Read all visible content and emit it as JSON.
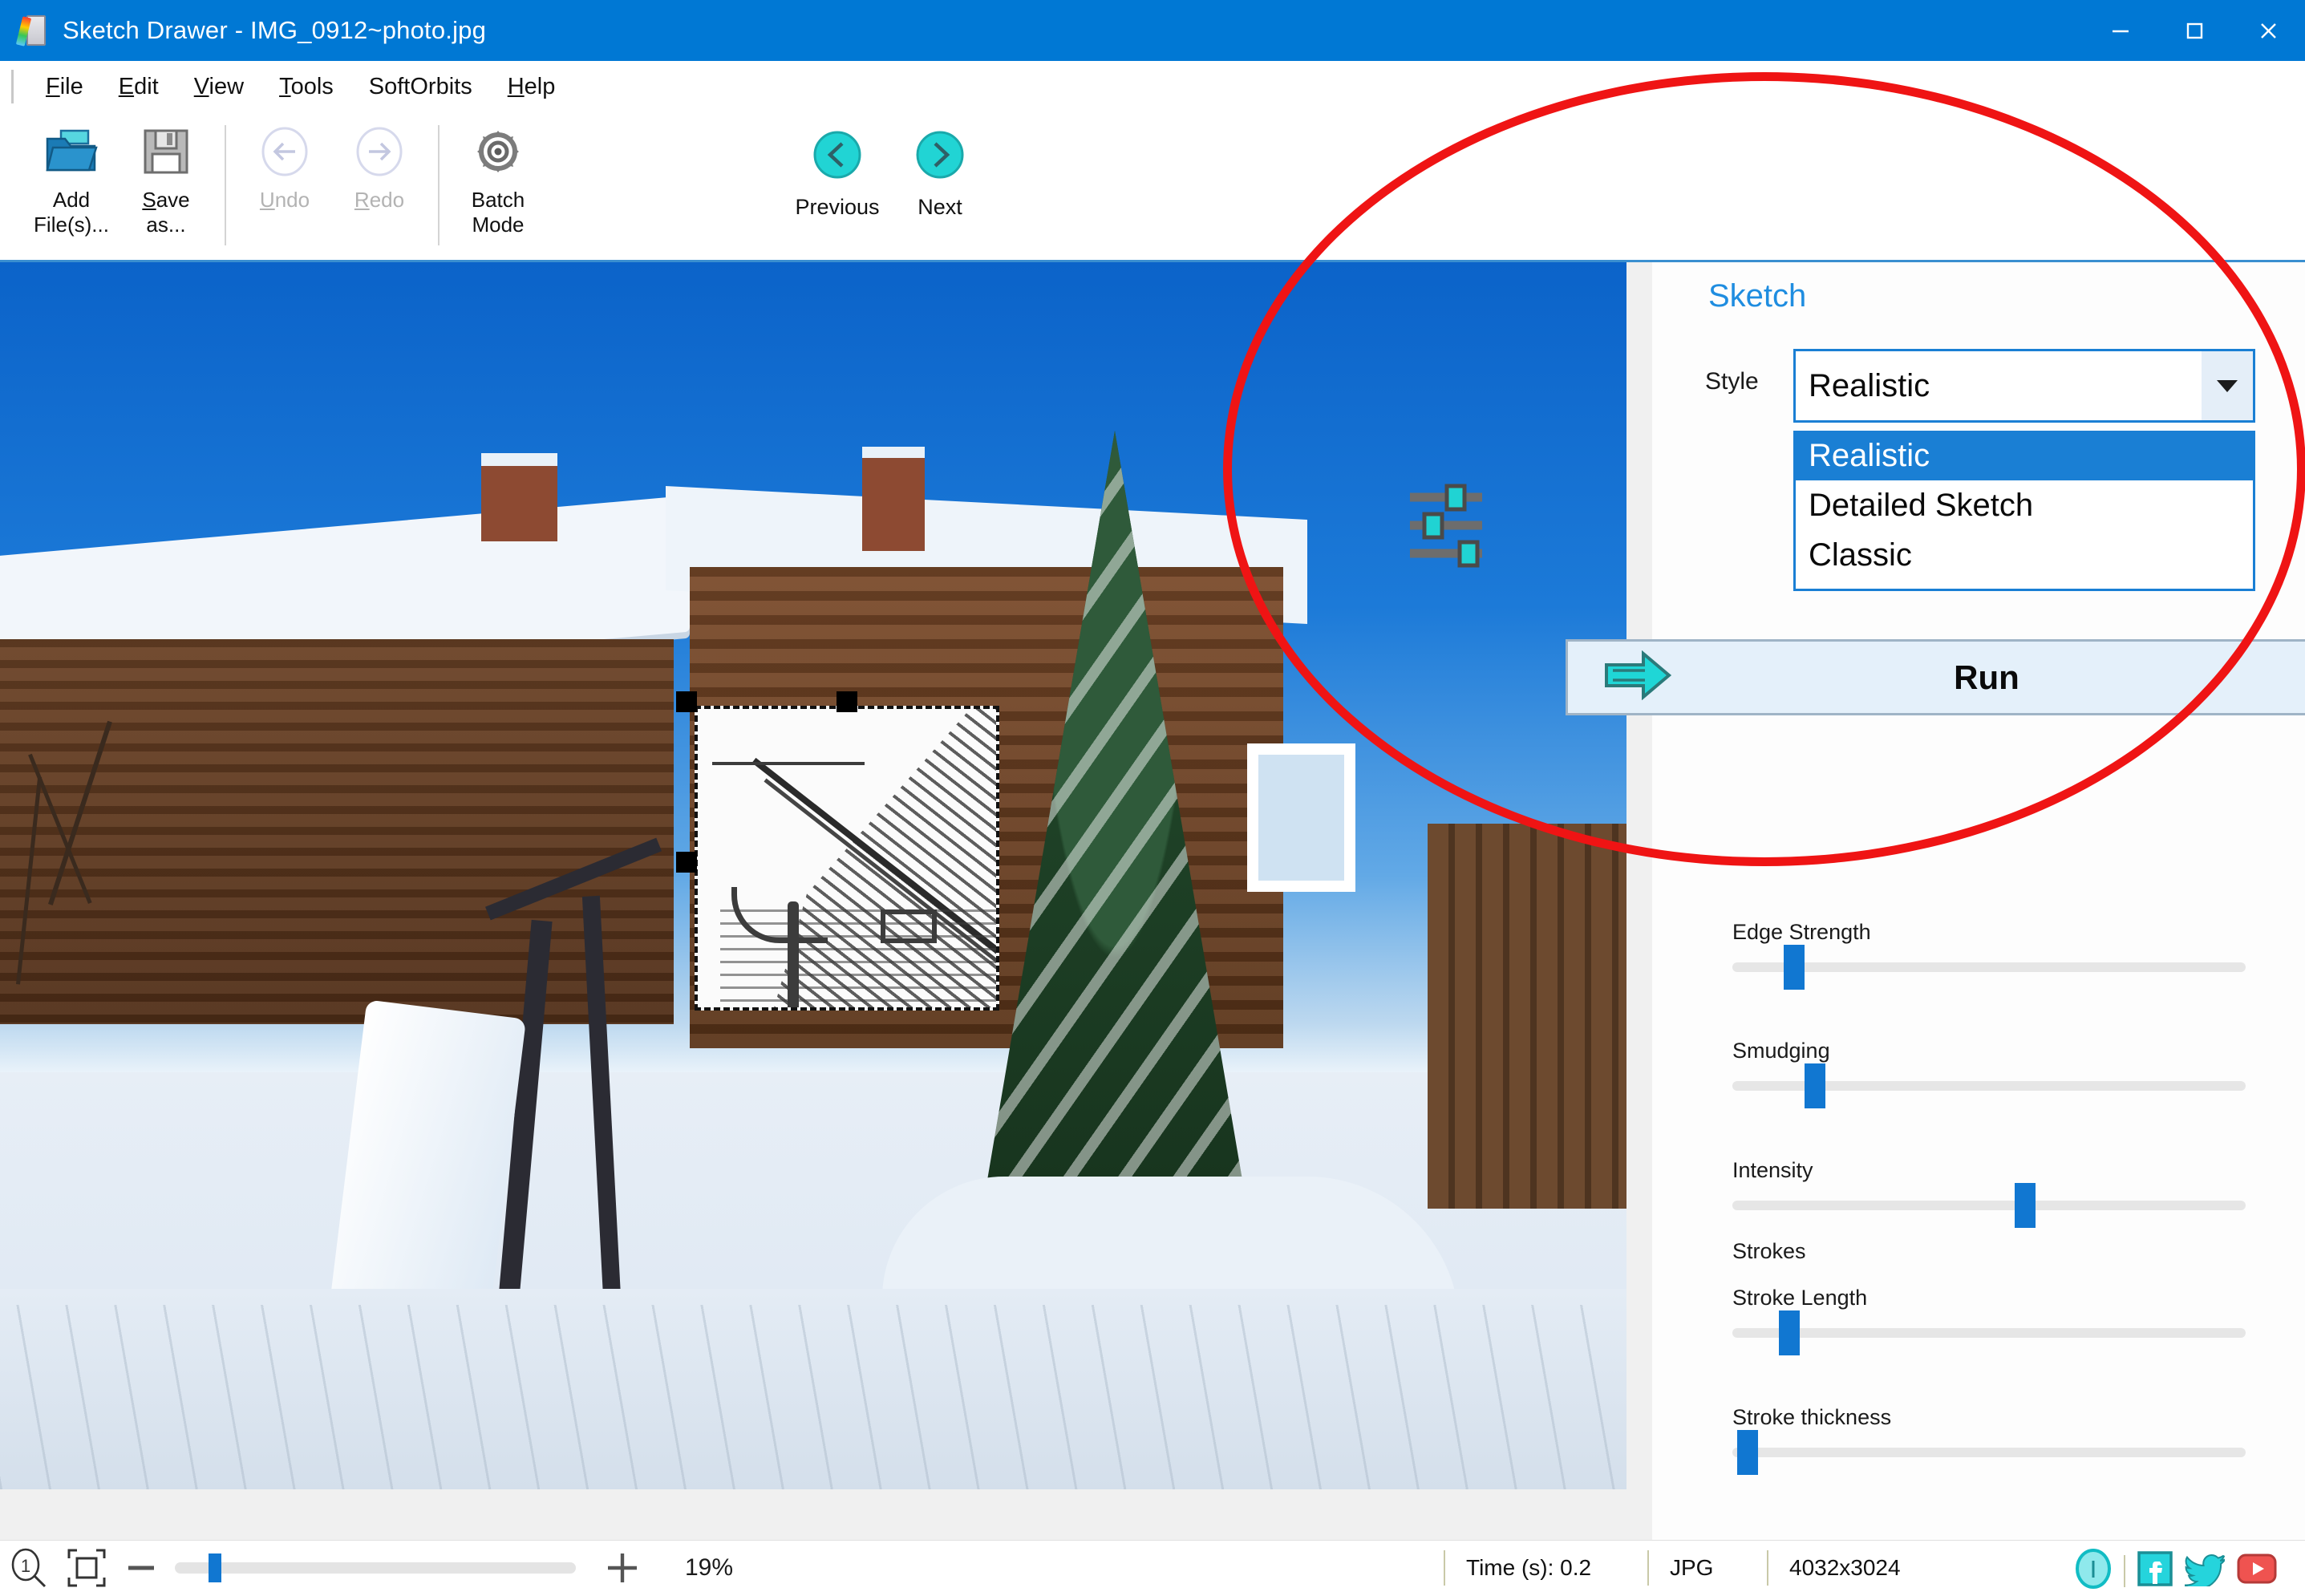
{
  "window": {
    "title": "Sketch Drawer - IMG_0912~photo.jpg",
    "app_icon": "sketch-pad-pencil-icon",
    "minimize_label": "—",
    "maximize_label": "□",
    "close_label": "✕",
    "titlebar_color": "#0078d4"
  },
  "menu": {
    "items": [
      {
        "label": "File",
        "prefix": "F",
        "rest": "ile"
      },
      {
        "label": "Edit",
        "prefix": "E",
        "rest": "dit"
      },
      {
        "label": "View",
        "prefix": "V",
        "rest": "iew"
      },
      {
        "label": "Tools",
        "prefix": "T",
        "rest": "ools"
      },
      {
        "label": "SoftOrbits",
        "prefix": "",
        "rest": "SoftOrbits"
      },
      {
        "label": "Help",
        "prefix": "H",
        "rest": "elp"
      }
    ]
  },
  "toolbar": {
    "add_files": {
      "label": "Add\nFile(s)...",
      "icon": "open-folder-icon",
      "enabled": true
    },
    "save_as": {
      "label": "Save\nas...",
      "icon": "floppy-disk-icon",
      "enabled": true
    },
    "undo": {
      "label": "Undo",
      "icon": "undo-arrow-icon",
      "enabled": false
    },
    "redo": {
      "label": "Redo",
      "icon": "redo-arrow-icon",
      "enabled": false
    },
    "batch": {
      "label": "Batch\nMode",
      "icon": "gear-icon",
      "enabled": true
    },
    "previous": {
      "label": "Previous",
      "icon": "chevron-left-circle-icon"
    },
    "next": {
      "label": "Next",
      "icon": "chevron-right-circle-icon"
    },
    "expander": "≡"
  },
  "panel": {
    "title": "Sketch",
    "style_label": "Style",
    "style_value": "Realistic",
    "style_options": [
      "Realistic",
      "Detailed Sketch",
      "Classic"
    ],
    "style_selected_index": 0,
    "presets_icon": "sliders-icon",
    "run_label": "Run",
    "run_icon": "right-arrow-icon",
    "accent_blue": "#1a7fd4",
    "accent_cyan": "#20c8cf",
    "sliders": [
      {
        "name": "Edge Strength",
        "value_pct": 10
      },
      {
        "name": "Smudging",
        "value_pct": 14
      },
      {
        "name": "Intensity",
        "value_pct": 55
      },
      {
        "name": "Strokes",
        "value_pct": null
      },
      {
        "name": "Stroke Length",
        "value_pct": 9
      },
      {
        "name": "Stroke thickness",
        "value_pct": 2
      }
    ]
  },
  "canvas": {
    "selection_handles": 4,
    "preview_alt": "sketch-preview-region"
  },
  "statusbar": {
    "zoom_100_icon": "zoom-actual-size-icon",
    "zoom_fit_icon": "zoom-fit-icon",
    "zoom_out_label": "—",
    "zoom_in_label": "+",
    "zoom_value": "19%",
    "zoom_slider_pct": 8,
    "time": "Time (s): 0.2",
    "format": "JPG",
    "dimensions": "4032x3024",
    "social": [
      {
        "name": "info-icon",
        "color": "#25d0d8"
      },
      {
        "name": "facebook-icon",
        "color": "#25d0d8"
      },
      {
        "name": "twitter-icon",
        "color": "#25d0d8"
      },
      {
        "name": "youtube-icon",
        "color": "#ef5350"
      }
    ]
  },
  "annotation": {
    "shape": "ellipse",
    "color": "#ef1414",
    "highlights": "style-dropdown-and-run-button"
  }
}
